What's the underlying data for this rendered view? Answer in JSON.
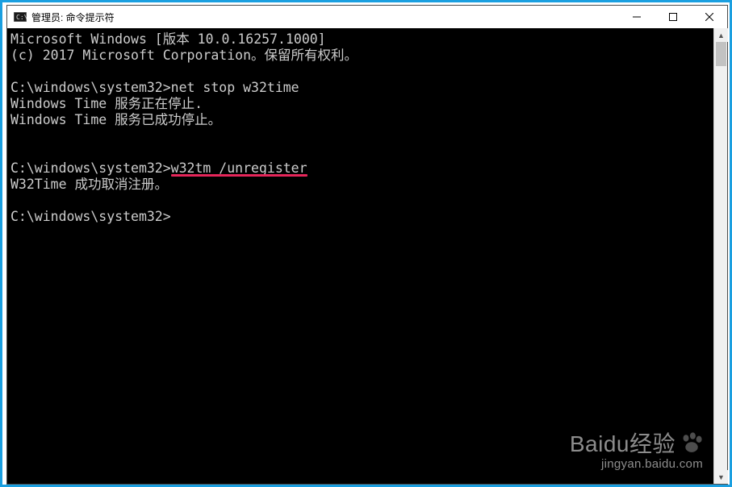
{
  "window": {
    "title": "管理员: 命令提示符"
  },
  "console": {
    "lines": [
      "Microsoft Windows [版本 10.0.16257.1000]",
      "(c) 2017 Microsoft Corporation。保留所有权利。",
      "",
      "C:\\windows\\system32>net stop w32time",
      "Windows Time 服务正在停止.",
      "Windows Time 服务已成功停止。",
      "",
      "",
      "C:\\windows\\system32>w32tm /unregister",
      "W32Time 成功取消注册。",
      "",
      "C:\\windows\\system32>"
    ],
    "highlight": {
      "line_index": 8,
      "text": "w32tm /unregister"
    }
  },
  "watermark": {
    "brand": "Baidu经验",
    "url": "jingyan.baidu.com"
  }
}
